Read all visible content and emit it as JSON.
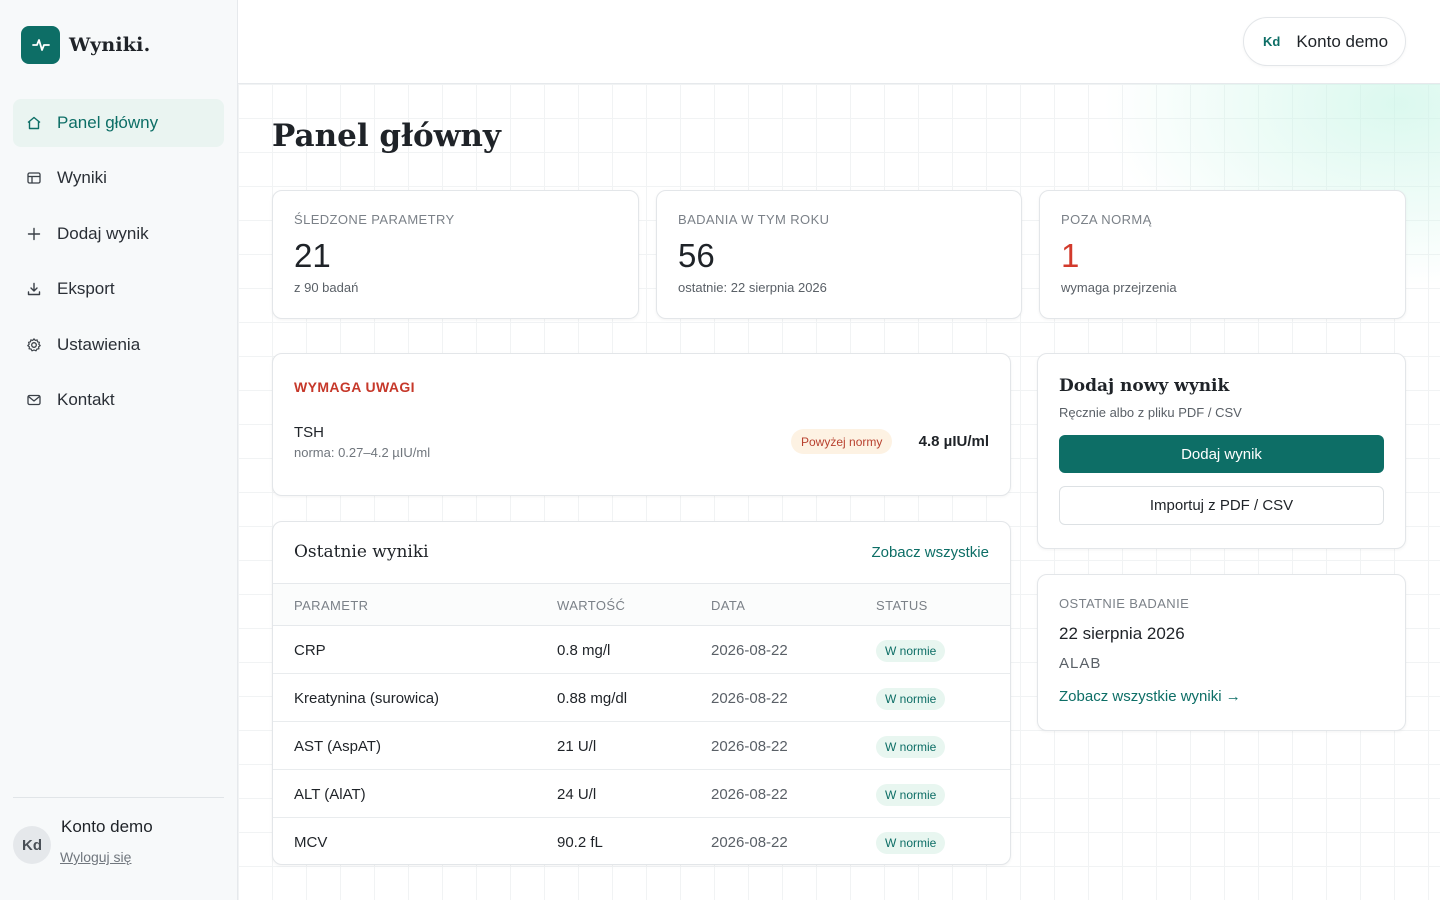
{
  "brand": {
    "name": "Wyniki.",
    "logo_icon": "pulse-icon",
    "accent": "#0d6e66"
  },
  "sidebar": {
    "items": [
      {
        "label": "Panel główny",
        "icon": "home-icon",
        "active": true
      },
      {
        "label": "Wyniki",
        "icon": "table-icon",
        "active": false
      },
      {
        "label": "Dodaj wynik",
        "icon": "plus-icon",
        "active": false
      },
      {
        "label": "Eksport",
        "icon": "download-icon",
        "active": false
      },
      {
        "label": "Ustawienia",
        "icon": "gear-icon",
        "active": false
      },
      {
        "label": "Kontakt",
        "icon": "mail-icon",
        "active": false
      }
    ],
    "user": {
      "initials": "Kd",
      "name": "Konto demo",
      "logout_label": "Wyloguj się"
    }
  },
  "topbar": {
    "account_initials": "Kd",
    "account_name": "Konto demo"
  },
  "page_title": "Panel główny",
  "stats": [
    {
      "label": "Śledzone parametry",
      "value": "21",
      "sub": "z 90 badań",
      "alert": false
    },
    {
      "label": "Badania w tym roku",
      "value": "56",
      "sub": "ostatnie: 22 sierpnia 2026",
      "alert": false
    },
    {
      "label": "Poza normą",
      "value": "1",
      "sub": "wymaga przejrzenia",
      "alert": true
    }
  ],
  "attention": {
    "title": "WYMAGA UWAGI",
    "param": "TSH",
    "norm": "norma: 0.27–4.2 µIU/ml",
    "badge": "Powyżej normy",
    "value": "4.8 µIU/ml"
  },
  "recent": {
    "title": "Ostatnie wyniki",
    "see_all": "Zobacz wszystkie",
    "columns": [
      "Parametr",
      "Wartość",
      "Data",
      "Status"
    ],
    "rows": [
      {
        "param": "CRP",
        "value": "0.8 mg/l",
        "date": "2026-08-22",
        "status": "W normie"
      },
      {
        "param": "Kreatynina (surowica)",
        "value": "0.88 mg/dl",
        "date": "2026-08-22",
        "status": "W normie"
      },
      {
        "param": "AST (AspAT)",
        "value": "21 U/l",
        "date": "2026-08-22",
        "status": "W normie"
      },
      {
        "param": "ALT (AlAT)",
        "value": "24 U/l",
        "date": "2026-08-22",
        "status": "W normie"
      },
      {
        "param": "MCV",
        "value": "90.2 fL",
        "date": "2026-08-22",
        "status": "W normie"
      }
    ]
  },
  "add_result": {
    "title": "Dodaj nowy wynik",
    "subtitle": "Ręcznie albo z pliku PDF / CSV",
    "primary_label": "Dodaj wynik",
    "secondary_label": "Importuj z PDF / CSV"
  },
  "last_exam": {
    "label": "Ostatnie badanie",
    "date": "22 sierpnia 2026",
    "lab": "ALAB",
    "link": "Zobacz wszystkie wyniki →"
  },
  "colors": {
    "accent": "#0d6e66",
    "alert": "#d23a2c",
    "ok_badge_bg": "#e8f6f0",
    "warn_badge_bg": "#fdf2e3"
  }
}
